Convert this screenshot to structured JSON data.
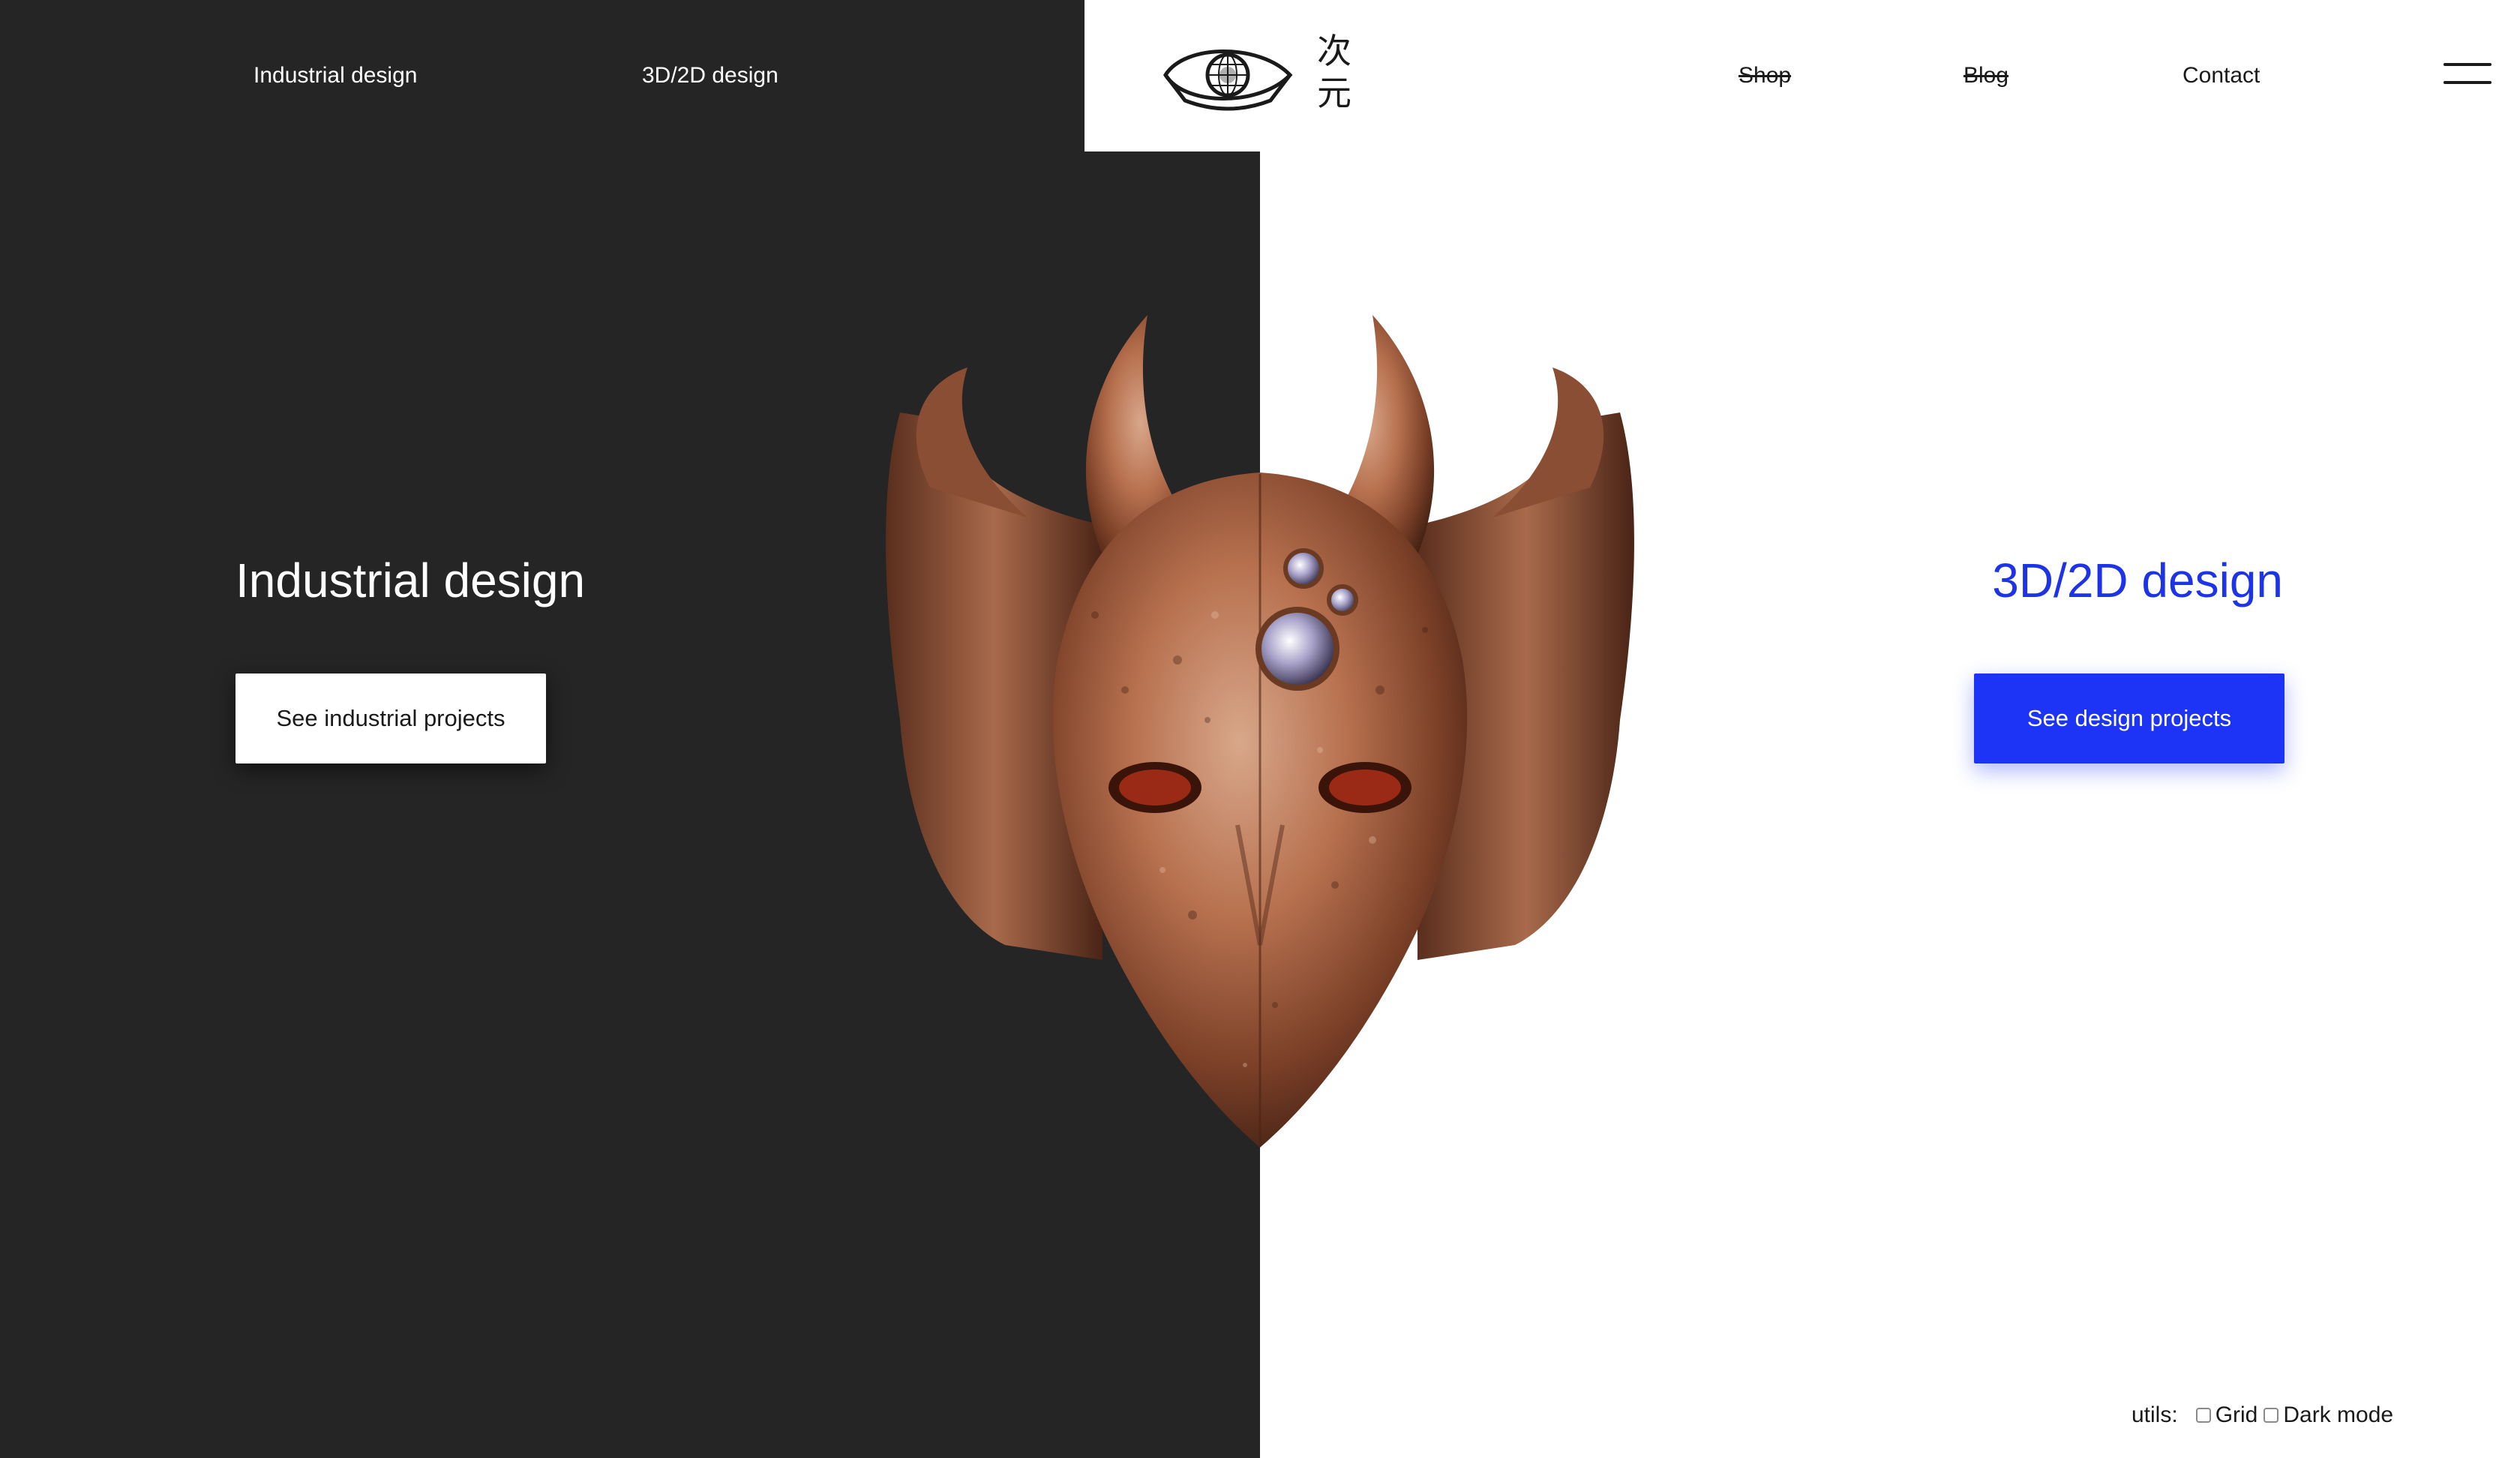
{
  "nav": {
    "left_links": [
      "Industrial design",
      "3D/2D design"
    ],
    "right_links": [
      "Shop",
      "Blog",
      "Contact"
    ]
  },
  "logo": {
    "glyphs": "次元"
  },
  "hero": {
    "left": {
      "title": "Industrial design",
      "button": "See industrial projects"
    },
    "right": {
      "title": "3D/2D design",
      "button": "See design projects"
    }
  },
  "utils": {
    "label": "utils:",
    "options": [
      {
        "label": "Grid",
        "checked": false
      },
      {
        "label": "Dark mode",
        "checked": false
      }
    ]
  },
  "colors": {
    "dark_bg": "#252525",
    "accent_blue": "#1d33f5",
    "copper": "#a8684a"
  },
  "icons": [
    "eye-logo-icon",
    "hamburger-menu-icon",
    "checkbox-icon"
  ]
}
